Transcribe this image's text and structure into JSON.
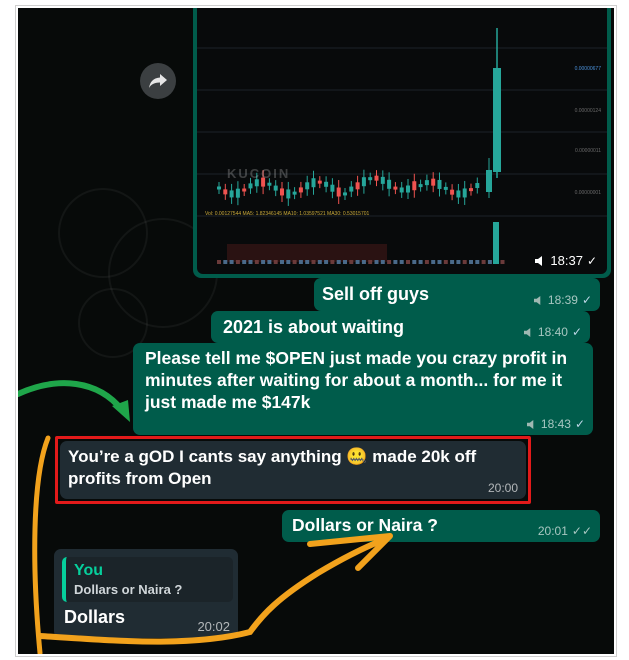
{
  "chart_message": {
    "time": "18:37",
    "status_icon": "double-check",
    "watermark": "KUCOIN",
    "indicators": "Vol: 0.00127544  MA5: 1.82346145  MA10: 1.03597521  MA30: 0.53015701",
    "price_labels": [
      "0.00000677",
      "0.00000124",
      "0.00000011",
      "0.00000001"
    ]
  },
  "messages": [
    {
      "text": "Sell off guys",
      "time": "18:39",
      "direction": "out"
    },
    {
      "text": "2021 is about waiting",
      "time": "18:40",
      "direction": "out"
    },
    {
      "text": "Please tell  me $OPEN just made you crazy profit in minutes after waiting for about a month... for me it just made me $147k",
      "time": "18:43",
      "direction": "out"
    },
    {
      "text": "You’re a gOD I cants say anything 🤐 made 20k off profits from Open",
      "time": "20:00",
      "direction": "in"
    },
    {
      "text": "Dollars or Naira ?",
      "time": "20:01",
      "direction": "out"
    },
    {
      "text": "Dollars",
      "time": "20:02",
      "direction": "in",
      "reply_to": {
        "author": "You",
        "text": "Dollars or Naira ?"
      }
    }
  ],
  "colors": {
    "outgoing": "#005c4b",
    "incoming": "#202c33",
    "highlight": "#e21a1a",
    "arrow_green": "#1fa64a",
    "arrow_orange": "#f2a21c"
  }
}
